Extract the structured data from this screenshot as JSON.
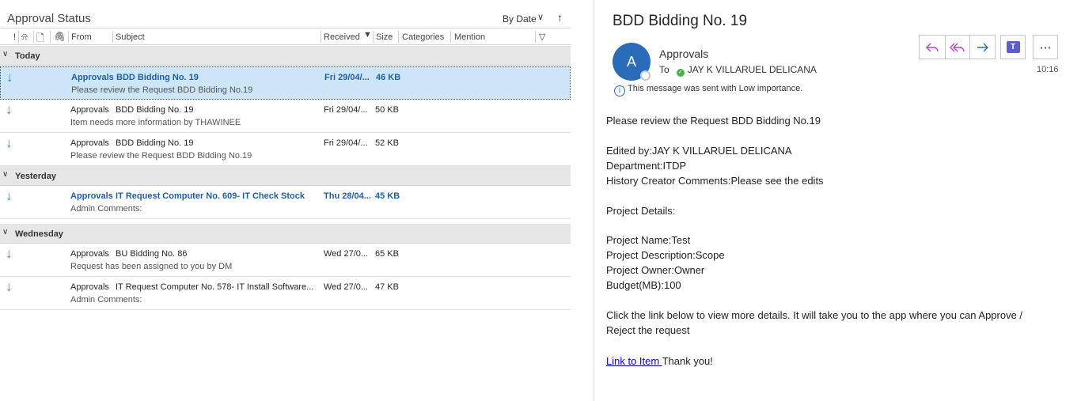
{
  "list": {
    "folder_title": "Approval Status",
    "sort_by": "By Date",
    "columns": {
      "importance": "!",
      "from": "From",
      "subject": "Subject",
      "received": "Received",
      "size": "Size",
      "categories": "Categories",
      "mention": "Mention"
    },
    "groups": [
      {
        "label": "Today"
      },
      {
        "label": "Yesterday"
      },
      {
        "label": "Wednesday"
      }
    ],
    "messages": [
      {
        "from": "Approvals",
        "subject": "BDD Bidding No. 19",
        "preview": "Please review the Request BDD Bidding No.19",
        "received": "Fri 29/04/...",
        "size": "46 KB"
      },
      {
        "from": "Approvals",
        "subject": "BDD Bidding No. 19",
        "preview": "Item needs more information by THAWINEE",
        "received": "Fri 29/04/...",
        "size": "50 KB"
      },
      {
        "from": "Approvals",
        "subject": "BDD Bidding No. 19",
        "preview": "Please review the Request BDD Bidding No.19",
        "received": "Fri 29/04/...",
        "size": "52 KB"
      },
      {
        "from": "Approvals",
        "subject": "IT Request Computer No. 609- IT Check Stock",
        "preview": "Admin Comments:",
        "received": "Thu 28/04...",
        "size": "45 KB"
      },
      {
        "from": "Approvals",
        "subject": "BU Bidding No. 86",
        "preview": "Request has been assigned to you by DM",
        "received": "Wed 27/0...",
        "size": "65 KB"
      },
      {
        "from": "Approvals",
        "subject": "IT Request Computer No. 578- IT Install Software...",
        "preview": "Admin Comments:",
        "received": "Wed 27/0...",
        "size": "47 KB"
      }
    ]
  },
  "reading": {
    "title": "BDD Bidding No. 19",
    "avatar_letter": "A",
    "sender": "Approvals",
    "to_label": "To",
    "recipient": "JAY K VILLARUEL DELICANA",
    "time": "10:16",
    "importance_note": "This message was sent with Low importance.",
    "body": {
      "line1": "Please review the Request BDD Bidding No.19",
      "edited_by": "Edited by:JAY K VILLARUEL DELICANA",
      "department": "Department:ITDP",
      "history": "History Creator Comments:Please see the edits",
      "project_details": "Project Details:",
      "project_name": "Project Name:Test",
      "project_desc": "Project Description:Scope",
      "project_owner": "Project Owner:Owner",
      "budget": "Budget(MB):100",
      "click_line1": "Click the link below to view more details. It will take you to the app where you can Approve /",
      "click_line2": "Reject the request",
      "link_text": "Link to Item ",
      "thanks": "Thank you!"
    }
  },
  "colors": {
    "accent": "#2b6cb8",
    "selected_row": "#cde6f7",
    "unread_text": "#1f5fa6",
    "group_header": "#e6e6e6",
    "teams": "#5b5fc7",
    "reply_icon": "#b146c2",
    "forward_icon": "#2b6cb8"
  }
}
